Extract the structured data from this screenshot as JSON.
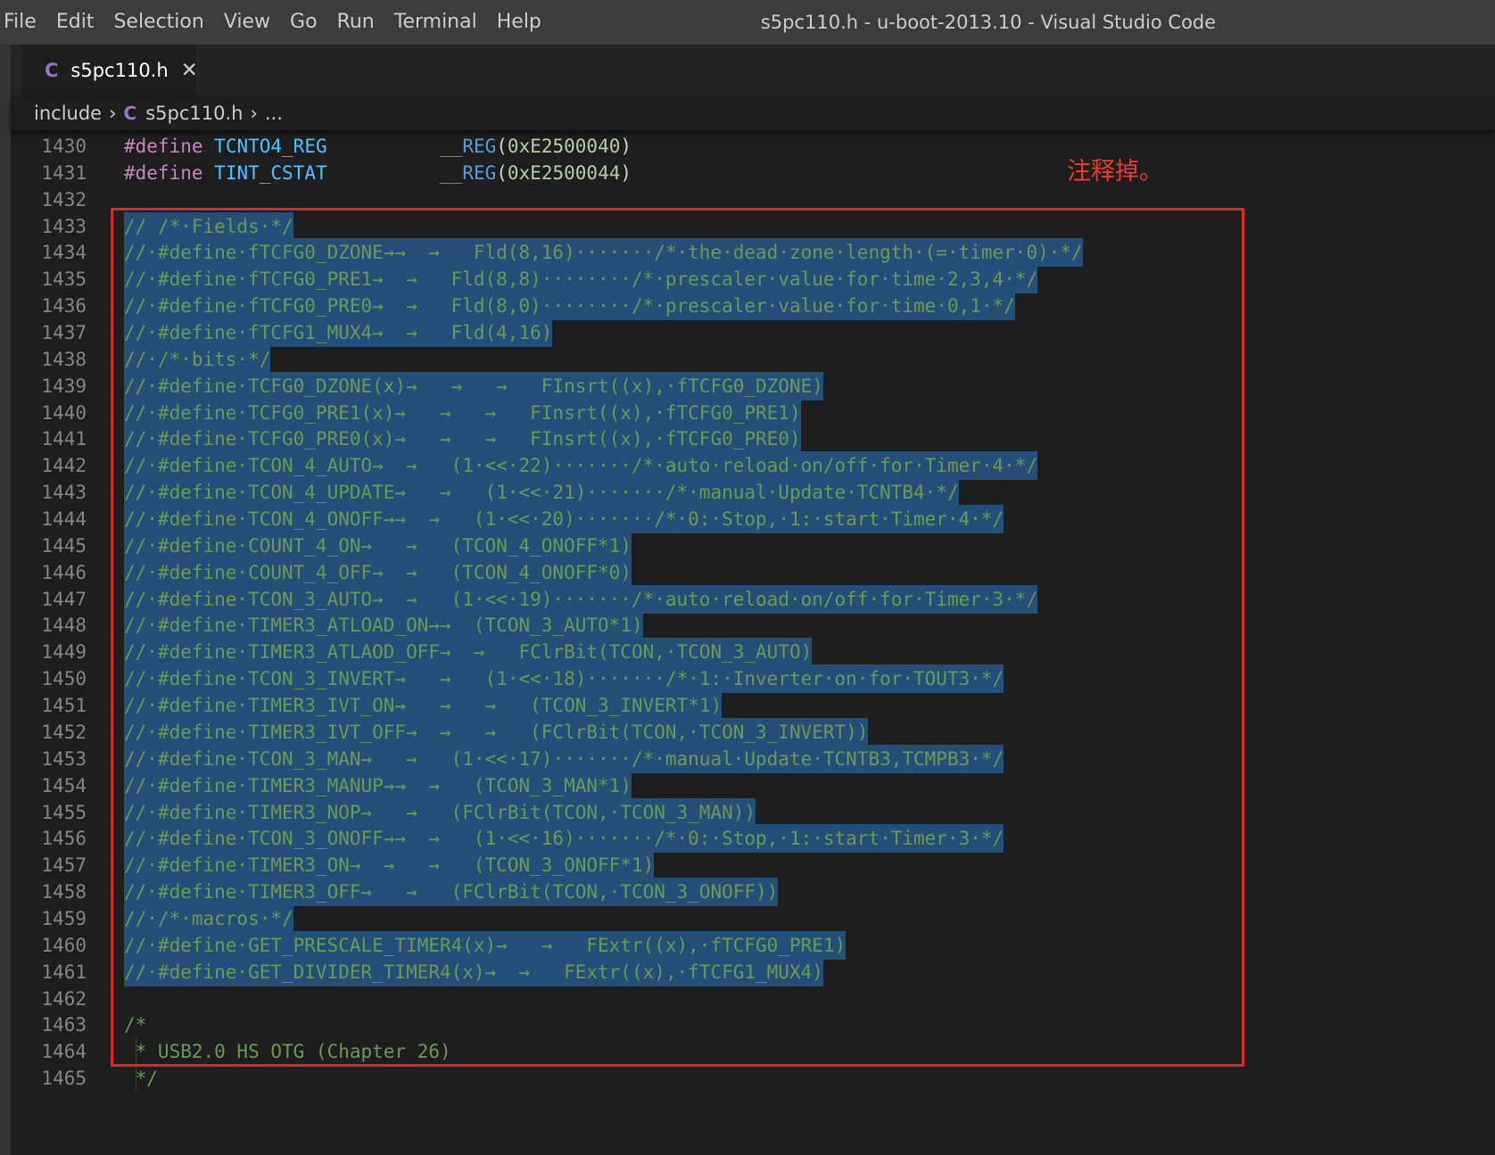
{
  "menu": [
    "File",
    "Edit",
    "Selection",
    "View",
    "Go",
    "Run",
    "Terminal",
    "Help"
  ],
  "window_title": "s5pc110.h - u-boot-2013.10 - Visual Studio Code",
  "tab": {
    "icon": "C",
    "label": "s5pc110.h",
    "close": "✕"
  },
  "breadcrumb": {
    "folder": "include",
    "icon": "C",
    "file": "s5pc110.h",
    "more": "..."
  },
  "annotation": "注释掉。",
  "top_lines": [
    {
      "n": "1430",
      "name": "TCNTO4_REG",
      "addr": "0xE2500040"
    },
    {
      "n": "1431",
      "name": "TINT_CSTAT",
      "addr": "0xE2500044"
    }
  ],
  "blank_line": "1432",
  "commented_lines": [
    {
      "n": "1433",
      "text": "// /*·Fields·*/"
    },
    {
      "n": "1434",
      "text": "//·#define·fTCFG0_DZONE→→  →   Fld(8,16)·······/*·the·dead·zone·length·(=·timer·0)·*/"
    },
    {
      "n": "1435",
      "text": "//·#define·fTCFG0_PRE1→  →   Fld(8,8)········/*·prescaler·value·for·time·2,3,4·*/"
    },
    {
      "n": "1436",
      "text": "//·#define·fTCFG0_PRE0→  →   Fld(8,0)········/*·prescaler·value·for·time·0,1·*/"
    },
    {
      "n": "1437",
      "text": "//·#define·fTCFG1_MUX4→  →   Fld(4,16)"
    },
    {
      "n": "1438",
      "text": "//·/*·bits·*/"
    },
    {
      "n": "1439",
      "text": "//·#define·TCFG0_DZONE(x)→   →   →   FInsrt((x),·fTCFG0_DZONE)"
    },
    {
      "n": "1440",
      "text": "//·#define·TCFG0_PRE1(x)→   →   →   FInsrt((x),·fTCFG0_PRE1)"
    },
    {
      "n": "1441",
      "text": "//·#define·TCFG0_PRE0(x)→   →   →   FInsrt((x),·fTCFG0_PRE0)"
    },
    {
      "n": "1442",
      "text": "//·#define·TCON_4_AUTO→  →   (1·<<·22)·······/*·auto·reload·on/off·for·Timer·4·*/"
    },
    {
      "n": "1443",
      "text": "//·#define·TCON_4_UPDATE→   →   (1·<<·21)·······/*·manual·Update·TCNTB4·*/"
    },
    {
      "n": "1444",
      "text": "//·#define·TCON_4_ONOFF→→  →   (1·<<·20)·······/*·0:·Stop,·1:·start·Timer·4·*/"
    },
    {
      "n": "1445",
      "text": "//·#define·COUNT_4_ON→   →   (TCON_4_ONOFF*1)"
    },
    {
      "n": "1446",
      "text": "//·#define·COUNT_4_OFF→  →   (TCON_4_ONOFF*0)"
    },
    {
      "n": "1447",
      "text": "//·#define·TCON_3_AUTO→  →   (1·<<·19)·······/*·auto·reload·on/off·for·Timer·3·*/"
    },
    {
      "n": "1448",
      "text": "//·#define·TIMER3_ATLOAD_ON→→  (TCON_3_AUTO*1)"
    },
    {
      "n": "1449",
      "text": "//·#define·TIMER3_ATLAOD_OFF→  →   FClrBit(TCON,·TCON_3_AUTO)"
    },
    {
      "n": "1450",
      "text": "//·#define·TCON_3_INVERT→   →   (1·<<·18)·······/*·1:·Inverter·on·for·TOUT3·*/"
    },
    {
      "n": "1451",
      "text": "//·#define·TIMER3_IVT_ON→   →   →   (TCON_3_INVERT*1)"
    },
    {
      "n": "1452",
      "text": "//·#define·TIMER3_IVT_OFF→  →   →   (FClrBit(TCON,·TCON_3_INVERT))"
    },
    {
      "n": "1453",
      "text": "//·#define·TCON_3_MAN→   →   (1·<<·17)·······/*·manual·Update·TCNTB3,TCMPB3·*/"
    },
    {
      "n": "1454",
      "text": "//·#define·TIMER3_MANUP→→  →   (TCON_3_MAN*1)"
    },
    {
      "n": "1455",
      "text": "//·#define·TIMER3_NOP→   →   (FClrBit(TCON,·TCON_3_MAN))"
    },
    {
      "n": "1456",
      "text": "//·#define·TCON_3_ONOFF→→  →   (1·<<·16)·······/*·0:·Stop,·1:·start·Timer·3·*/"
    },
    {
      "n": "1457",
      "text": "//·#define·TIMER3_ON→  →   →   (TCON_3_ONOFF*1)"
    },
    {
      "n": "1458",
      "text": "//·#define·TIMER3_OFF→   →   (FClrBit(TCON,·TCON_3_ONOFF))"
    },
    {
      "n": "1459",
      "text": "//·/*·macros·*/"
    },
    {
      "n": "1460",
      "text": "//·#define·GET_PRESCALE_TIMER4(x)→   →   FExtr((x),·fTCFG0_PRE1)"
    },
    {
      "n": "1461",
      "text": "//·#define·GET_DIVIDER_TIMER4(x)→  →   FExtr((x),·fTCFG1_MUX4)"
    }
  ],
  "bottom_lines": [
    {
      "n": "1462",
      "text": ""
    },
    {
      "n": "1463",
      "text": "/*"
    },
    {
      "n": "1464",
      "text": " * USB2.0 HS OTG (Chapter 26)"
    },
    {
      "n": "1465",
      "text": " */"
    }
  ]
}
